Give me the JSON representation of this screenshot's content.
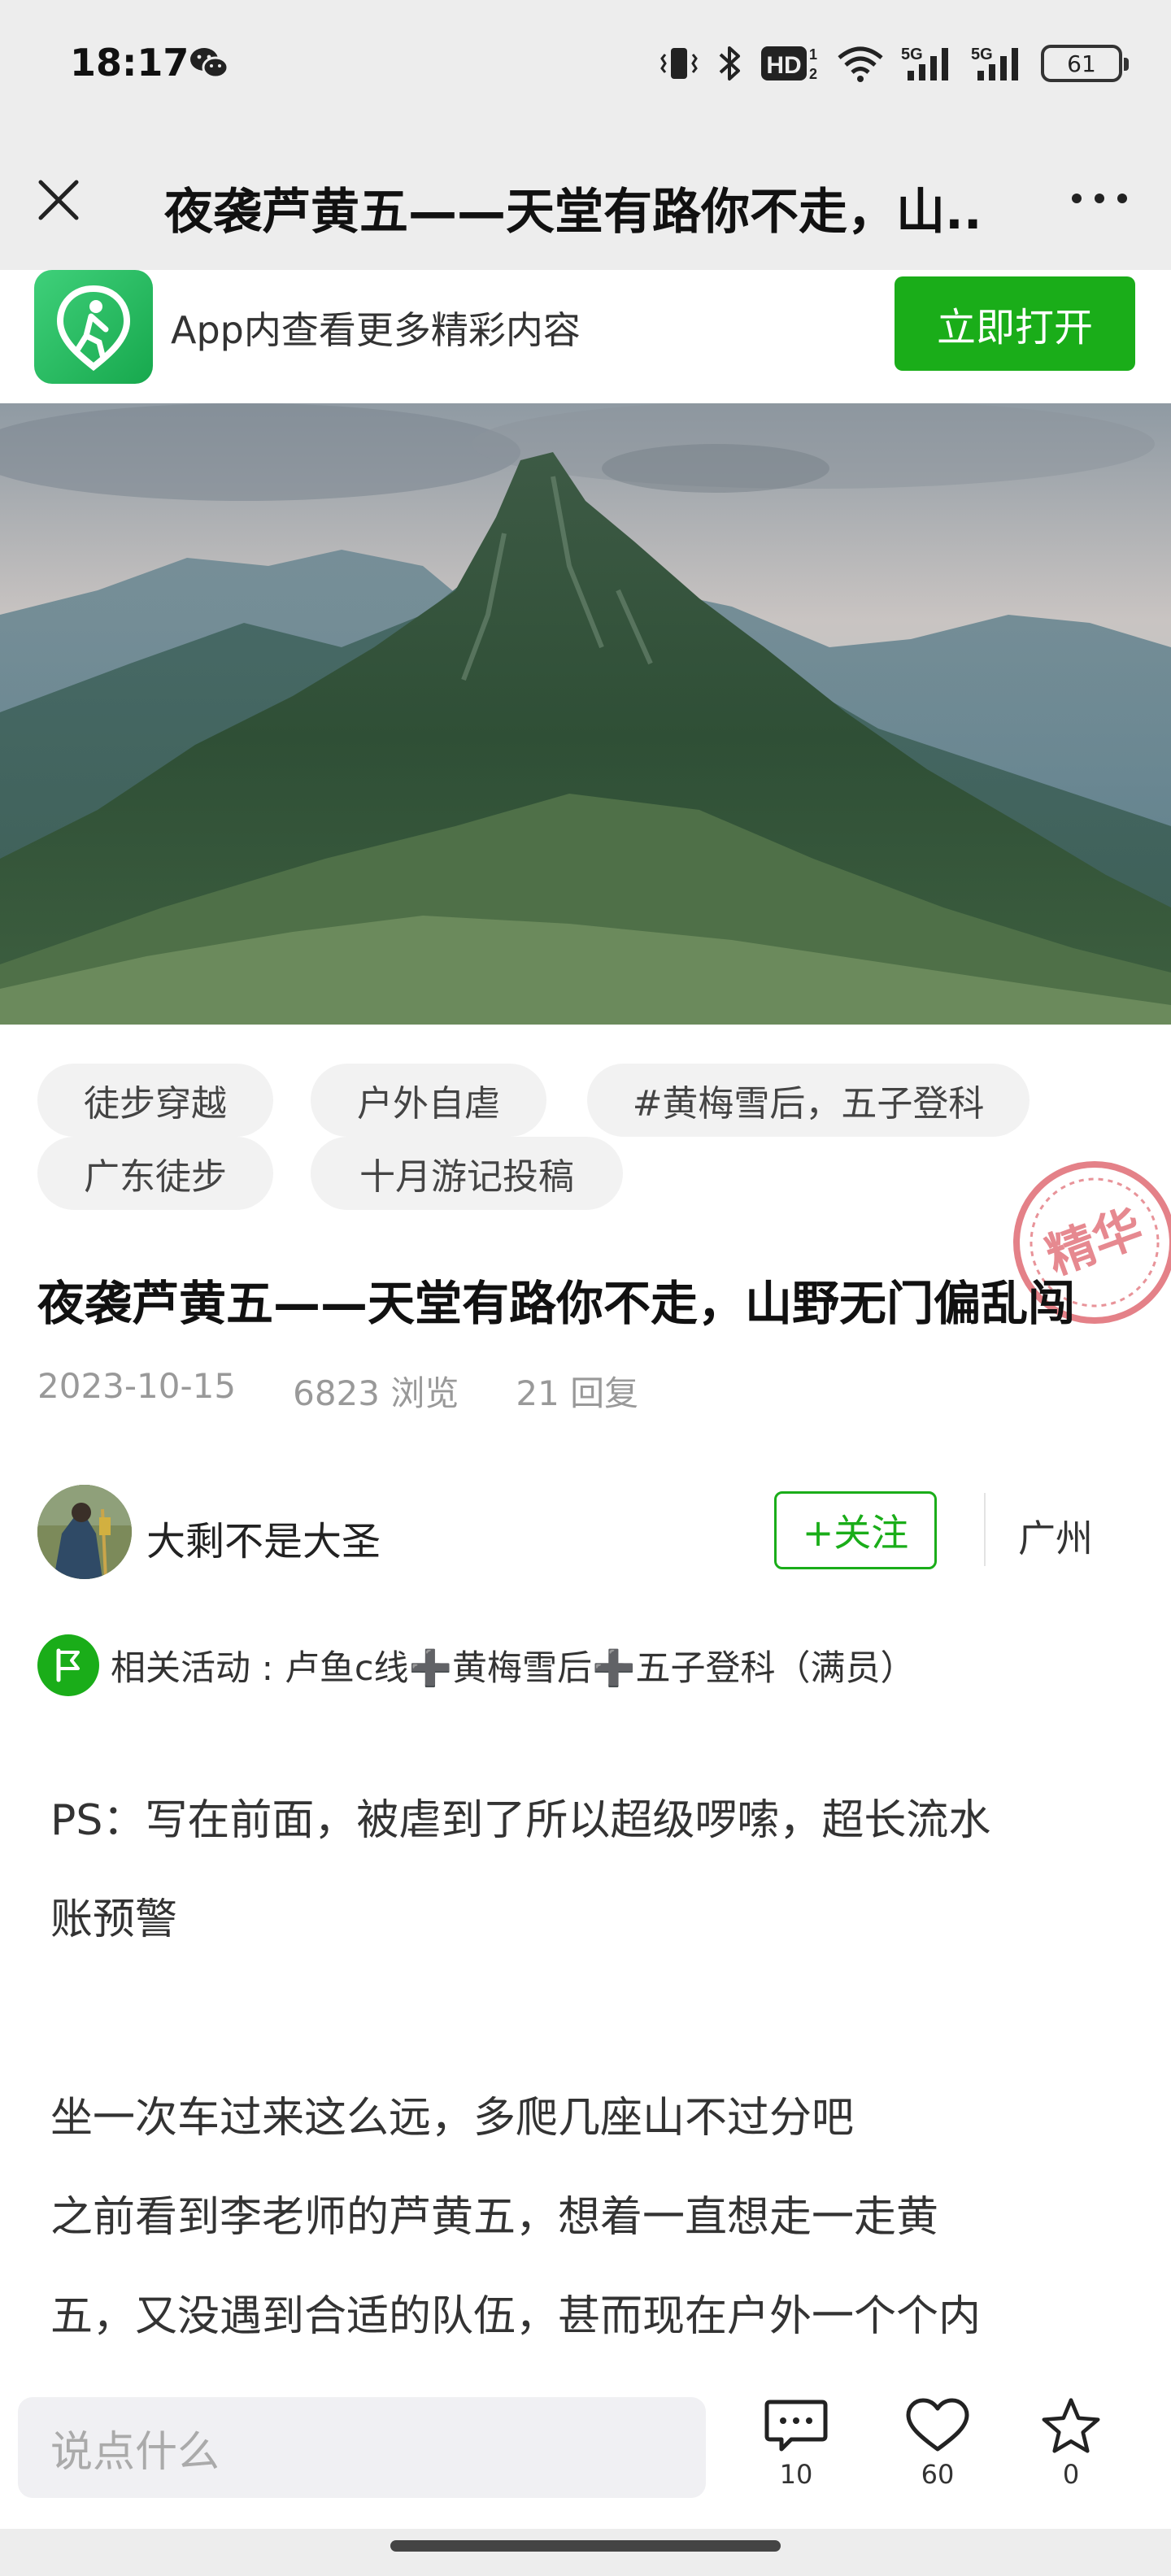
{
  "status_bar": {
    "time": "18:17",
    "battery": "61",
    "icons": [
      "wechat-icon",
      "vibrate-icon",
      "bluetooth-icon",
      "hd-icon",
      "wifi-icon",
      "signal-5g-icon",
      "signal-5g-icon"
    ]
  },
  "navbar": {
    "title": "夜袭芦黄五——天堂有路你不走，山...",
    "close_icon": "close-icon",
    "more_icon": "more-icon"
  },
  "app_banner": {
    "text": "App内查看更多精彩内容",
    "open_button": "立即打开"
  },
  "tags": [
    "徒步穿越",
    "户外自虐",
    "#黄梅雪后，五子登科",
    "广东徒步",
    "十月游记投稿"
  ],
  "stamp": {
    "text": "精华"
  },
  "post": {
    "title": "夜袭芦黄五——天堂有路你不走，山野无门偏乱闯",
    "date": "2023-10-15",
    "views": "6823 浏览",
    "replies": "21 回复"
  },
  "author": {
    "name": "大剩不是大圣",
    "follow_button": "+关注",
    "city": "广州"
  },
  "activity": {
    "text": "相关活动 : 卢鱼c线➕黄梅雪后➕五子登科（满员）"
  },
  "body": {
    "lines": [
      "PS：写在前面，被虐到了所以超级啰嗦，超长流水",
      "账预警",
      "坐一次车过来这么远，多爬几座山不过分吧",
      "之前看到李老师的芦黄五，想着一直想走一走黄",
      "五，又没遇到合适的队伍，甚而现在户外一个个内"
    ]
  },
  "bottom_bar": {
    "input_placeholder": "说点什么",
    "comments": "10",
    "likes": "60",
    "favorites": "0"
  },
  "colors": {
    "accent_green": "#1aad19",
    "stamp_red": "#d94b55",
    "chrome_gray": "#ededed"
  }
}
